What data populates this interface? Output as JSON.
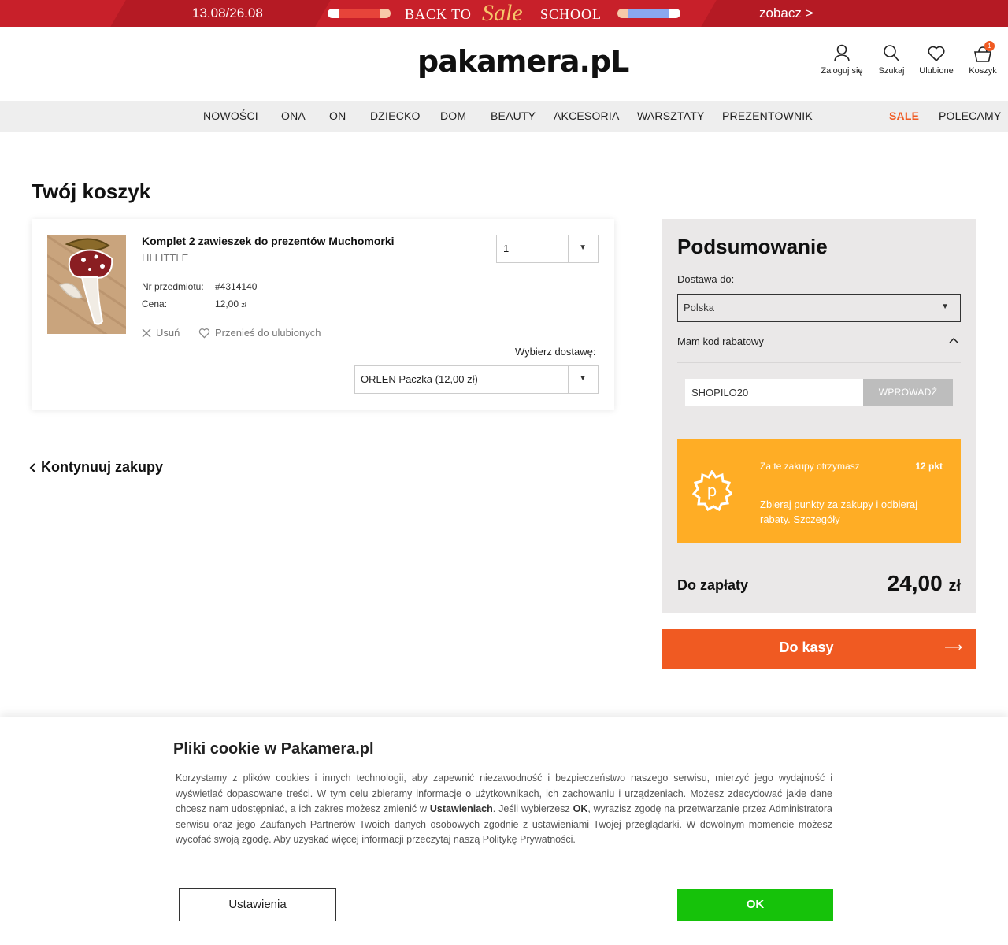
{
  "promo": {
    "dates": "13.08/26.08",
    "word_back_to": "BACK TO",
    "word_sale": "Sale",
    "word_school": "SCHOOL",
    "cta": "zobacz >",
    "colors": {
      "background": "#c8202a",
      "sale_text": "#f6c66b"
    }
  },
  "header": {
    "logo": "pakamera.pL",
    "icons": [
      {
        "name": "user-icon",
        "label": "Zaloguj się"
      },
      {
        "name": "search-icon",
        "label": "Szukaj"
      },
      {
        "name": "heart-icon",
        "label": "Ulubione"
      },
      {
        "name": "cart-icon",
        "label": "Koszyk",
        "badge": "1"
      }
    ]
  },
  "nav": {
    "items": [
      "NOWOŚCI",
      "ONA",
      "ON",
      "DZIECKO",
      "DOM",
      "BEAUTY",
      "AKCESORIA",
      "WARSZTATY",
      "PREZENTOWNIK"
    ],
    "sale": "SALE",
    "recommended": "POLECAMY"
  },
  "page": {
    "title": "Twój koszyk"
  },
  "cart_item": {
    "title": "Komplet 2 zawieszek do prezentów Muchomorki",
    "brand": "HI LITTLE",
    "item_no_label": "Nr przedmiotu:",
    "item_no": "#4314140",
    "price_label": "Cena:",
    "price": "12,00",
    "price_currency": "zł",
    "quantity": "1",
    "remove_label": "Usuń",
    "move_to_favorites_label": "Przenieś do ulubionych",
    "shipping_label": "Wybierz dostawę:",
    "shipping_value": "ORLEN Paczka (12,00 zł)"
  },
  "continue_shopping": "Kontynuuj zakupy",
  "summary": {
    "title": "Podsumowanie",
    "ship_to_label": "Dostawa do:",
    "country": "Polska",
    "coupon_toggle": "Mam kod rabatowy",
    "coupon_value": "SHOPILO20",
    "coupon_button": "WPROWADŹ",
    "points_head": "Za te zakupy otrzymasz",
    "points_value": "12 pkt",
    "points_desc": "Zbieraj punkty za zakupy i odbieraj rabaty.",
    "points_link": "Szczegóły",
    "total_label": "Do zapłaty",
    "total_value": "24,00",
    "total_currency": "zł",
    "checkout_label": "Do kasy",
    "colors": {
      "points_box": "#ffad25",
      "checkout": "#f05a22"
    }
  },
  "cookie": {
    "title": "Pliki cookie w Pakamera.pl",
    "text_1": "Korzystamy z plików cookies i innych technologii, aby zapewnić niezawodność i bezpieczeństwo naszego serwisu, mierzyć jego wydajność i wyświetlać dopasowane treści. W tym celu zbieramy informacje o użytkownikach, ich zachowaniu i urządzeniach. Możesz zdecydować jakie dane chcesz nam udostępniać, a ich zakres możesz zmienić w ",
    "text_settings_bold": "Ustawieniach",
    "text_2": ". Jeśli wybierzesz ",
    "text_ok_bold": "OK",
    "text_3": ", wyrazisz zgodę na przetwarzanie przez Administratora serwisu oraz jego Zaufanych Partnerów Twoich danych osobowych zgodnie z ustawieniami Twojej przeglądarki. W dowolnym momencie możesz wycofać swoją zgodę. Aby uzyskać więcej informacji przeczytaj naszą Politykę Prywatności.",
    "settings_button": "Ustawienia",
    "ok_button": "OK",
    "colors": {
      "ok": "#16c20a"
    }
  }
}
